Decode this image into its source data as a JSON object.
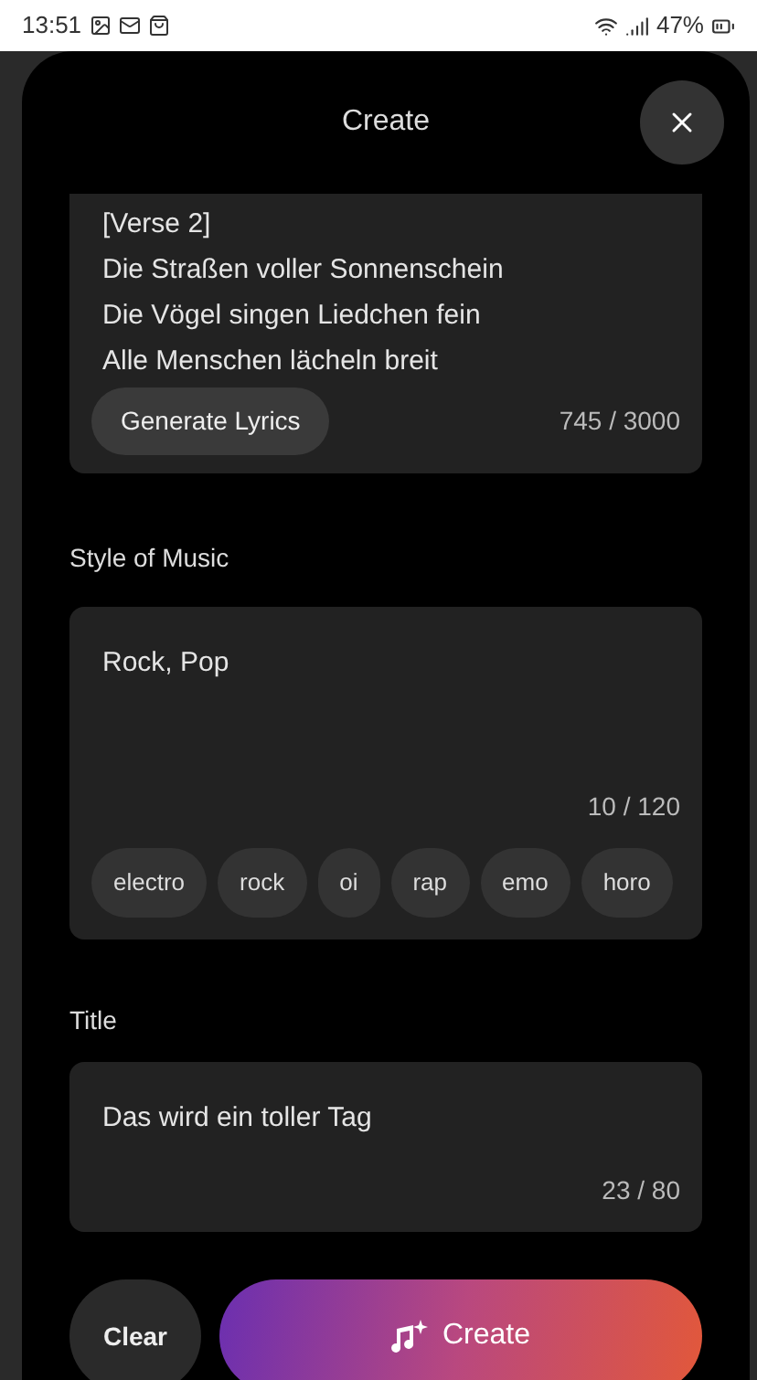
{
  "status_bar": {
    "time": "13:51",
    "battery": "47%"
  },
  "header": {
    "title": "Create"
  },
  "lyrics": {
    "lines": [
      "[Verse 2]",
      "Die Straßen voller Sonnenschein",
      "Die Vögel singen Liedchen fein",
      "Alle Menschen lächeln breit"
    ],
    "generate_button": "Generate Lyrics",
    "count": "745 / 3000"
  },
  "style": {
    "label": "Style of Music",
    "value": "Rock, Pop",
    "count": "10 / 120",
    "tags": [
      "electro",
      "rock",
      "oi",
      "rap",
      "emo",
      "horo"
    ]
  },
  "title": {
    "label": "Title",
    "value": "Das wird ein toller Tag",
    "count": "23 / 80"
  },
  "buttons": {
    "clear": "Clear",
    "create": "Create"
  }
}
